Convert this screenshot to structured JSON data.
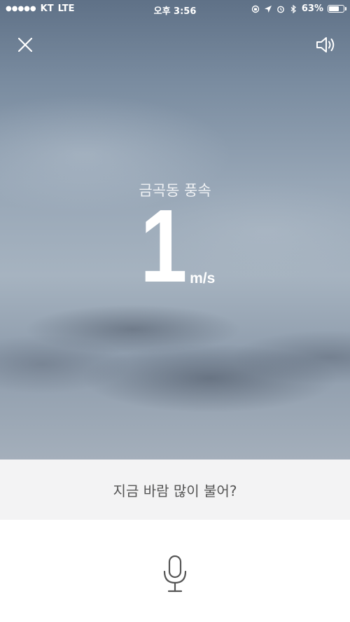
{
  "status_bar": {
    "signal": "●●●●●",
    "carrier": "KT",
    "network": "LTE",
    "time": "오후 3:56",
    "battery_percent": "63%",
    "battery_level": 0.63,
    "icons": [
      "orientation-lock-icon",
      "location-arrow-icon",
      "alarm-icon",
      "bluetooth-icon",
      "battery-icon"
    ]
  },
  "controls": {
    "close_icon": "close-icon",
    "speaker_icon": "speaker-icon"
  },
  "wind": {
    "title": "금곡동 풍속",
    "value": "1",
    "unit": "m/s"
  },
  "prompt": {
    "text": "지금 바람 많이 불어?"
  },
  "mic": {
    "icon": "microphone-icon"
  },
  "colors": {
    "sky_top": "#5f7187",
    "sky_mid": "#a6b3c0",
    "prompt_bg": "#f3f3f4",
    "prompt_text": "#555555",
    "icon_gray": "#555555"
  }
}
